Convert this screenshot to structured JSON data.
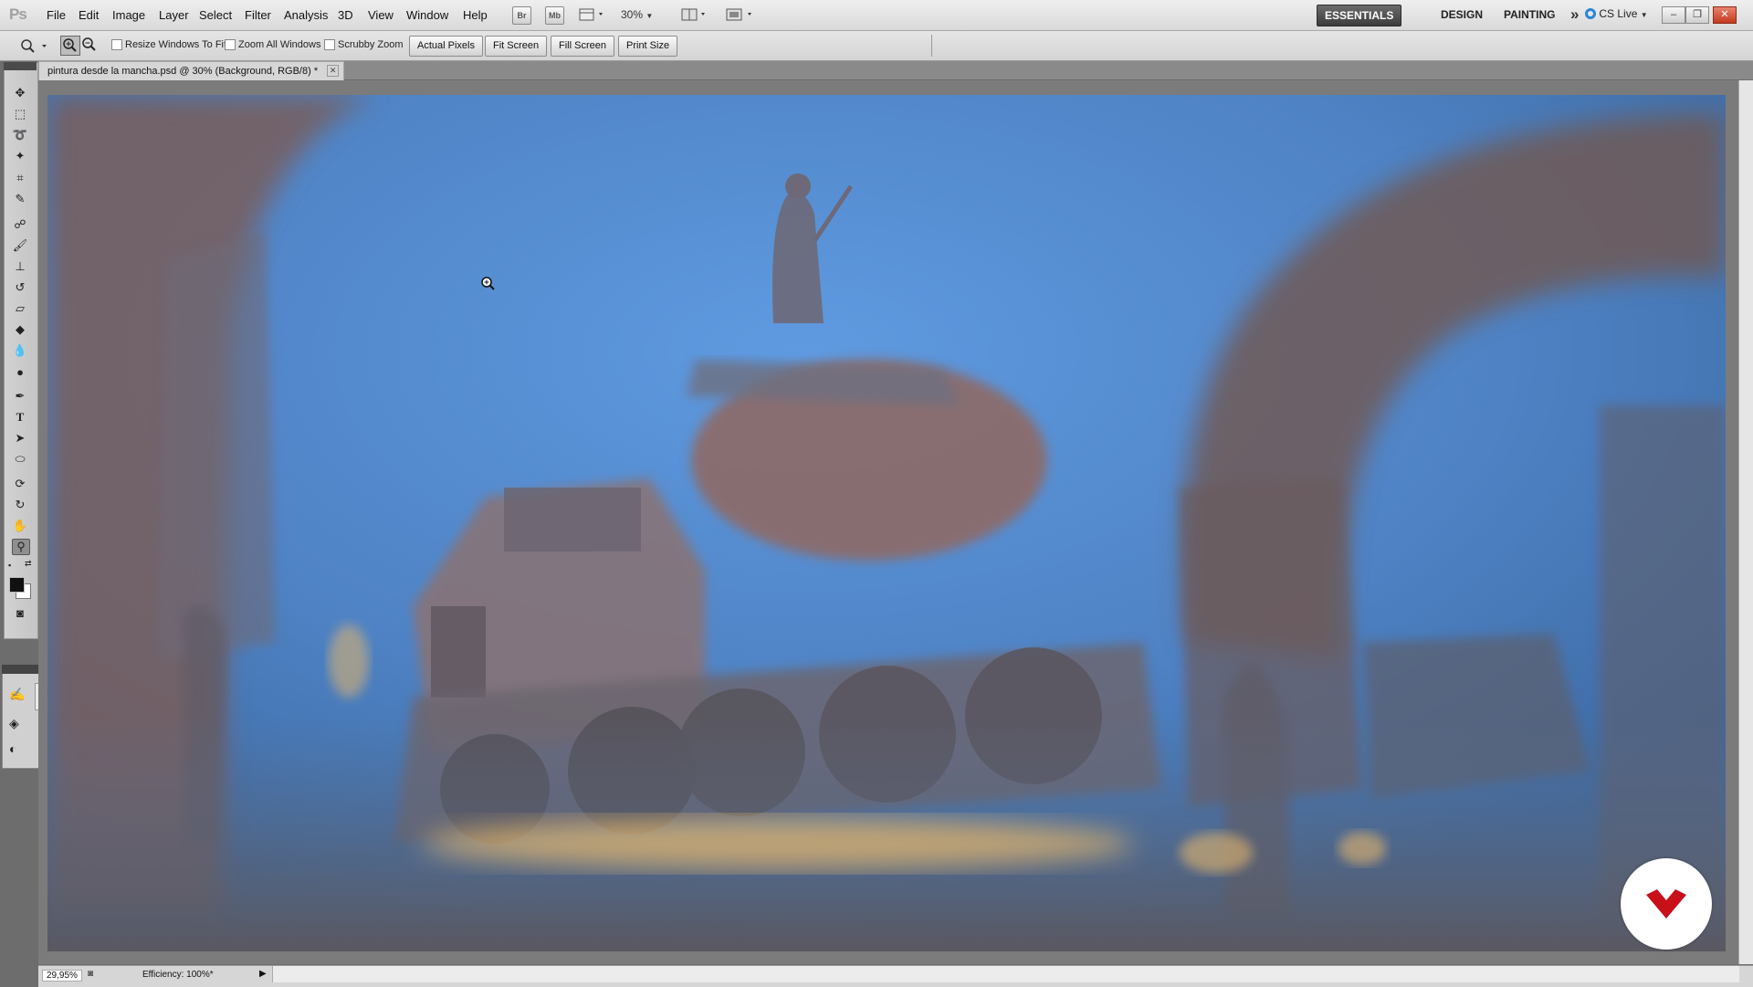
{
  "app": {
    "logo": "Ps"
  },
  "menu": [
    "File",
    "Edit",
    "Image",
    "Layer",
    "Select",
    "Filter",
    "Analysis",
    "3D",
    "View",
    "Window",
    "Help"
  ],
  "toolbar_icons": {
    "bridge": "Br",
    "minibridge": "Mb"
  },
  "zoom_level": "30%",
  "workspaces": {
    "essentials": "ESSENTIALS",
    "design": "DESIGN",
    "painting": "PAINTING",
    "more": "»"
  },
  "cslive": "CS Live",
  "window_controls": {
    "minimize": "–",
    "restore": "❐",
    "close": "✕"
  },
  "options": {
    "resize_windows": "Resize Windows To Fit",
    "zoom_all_windows": "Zoom All Windows",
    "scrubby_zoom": "Scrubby Zoom",
    "actual_pixels": "Actual Pixels",
    "fit_screen": "Fit Screen",
    "fill_screen": "Fill Screen",
    "print_size": "Print Size"
  },
  "document": {
    "tab_title": "pintura desde la mancha.psd @ 30% (Background, RGB/8) *",
    "tab_close": "✕"
  },
  "status": {
    "zoom": "29,95%",
    "efficiency": "Efficiency: 100%*",
    "arrow": "▶"
  },
  "icons": {
    "zoom_tool": "magnifier-icon",
    "move": "move-icon",
    "marquee": "marquee-icon",
    "lasso": "lasso-icon",
    "quick_select": "quick-select-icon",
    "crop": "crop-icon",
    "eyedropper": "eyedropper-icon",
    "heal": "heal-icon",
    "brush": "brush-icon",
    "stamp": "stamp-icon",
    "history_brush": "history-brush-icon",
    "eraser": "eraser-icon",
    "bucket": "bucket-icon",
    "blur": "blur-icon",
    "dodge": "dodge-icon",
    "pen": "pen-icon",
    "type": "type-icon",
    "path_select": "path-select-icon",
    "shape": "shape-icon",
    "3d_rotate": "3d-rotate-icon",
    "3d_orbit": "3d-orbit-icon",
    "hand": "hand-icon",
    "zoom": "zoom-icon",
    "quick_mask": "quick-mask-icon"
  },
  "colors": {
    "accent": "#3c3c3c",
    "sky": "#5b8fd6",
    "rust": "#8a5a48",
    "glow": "#e6b66a",
    "watermark": "#c8101a"
  }
}
